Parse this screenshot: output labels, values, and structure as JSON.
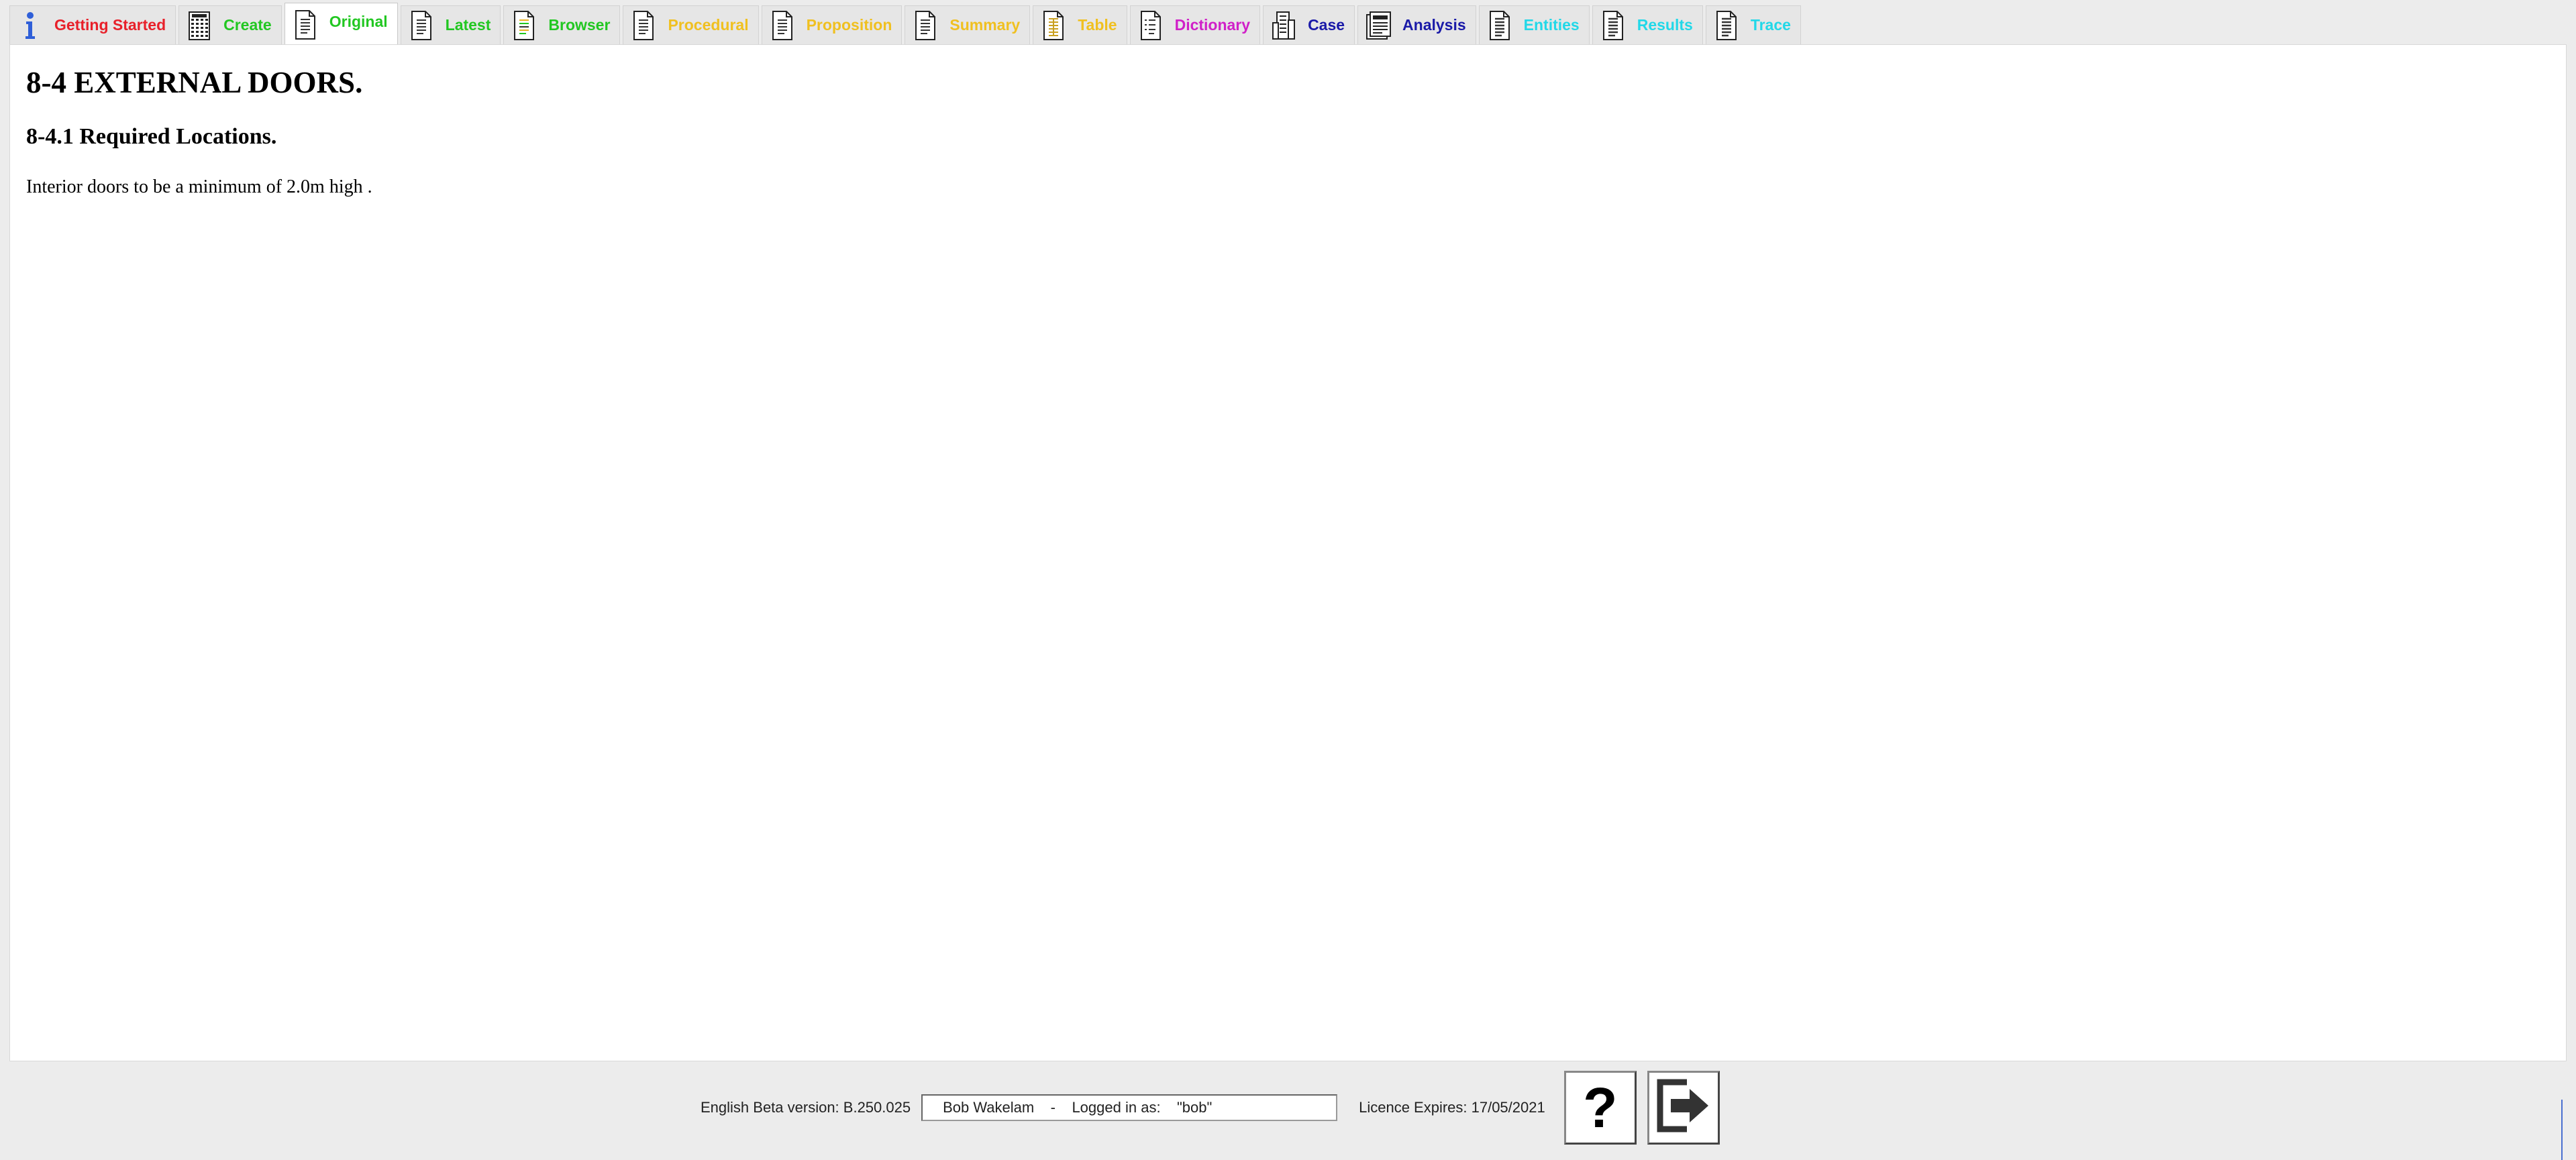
{
  "tabs": [
    {
      "label": "Getting Started",
      "color": "#e8202a",
      "icon": "info-icon",
      "active": false
    },
    {
      "label": "Create",
      "color": "#22c722",
      "icon": "calculator-icon",
      "active": false
    },
    {
      "label": "Original",
      "color": "#22c722",
      "icon": "document-icon",
      "active": true
    },
    {
      "label": "Latest",
      "color": "#22c722",
      "icon": "document-icon",
      "active": false
    },
    {
      "label": "Browser",
      "color": "#22c722",
      "icon": "colored-document-icon",
      "active": false
    },
    {
      "label": "Procedural",
      "color": "#f0c020",
      "icon": "document-icon",
      "active": false
    },
    {
      "label": "Proposition",
      "color": "#f0c020",
      "icon": "document-icon",
      "active": false
    },
    {
      "label": "Summary",
      "color": "#f0c020",
      "icon": "document-icon",
      "active": false
    },
    {
      "label": "Table",
      "color": "#f0c020",
      "icon": "table-document-icon",
      "active": false
    },
    {
      "label": "Dictionary",
      "color": "#d020c8",
      "icon": "dictionary-icon",
      "active": false
    },
    {
      "label": "Case",
      "color": "#1a1aa8",
      "icon": "building-icon",
      "active": false
    },
    {
      "label": "Analysis",
      "color": "#1a1aa8",
      "icon": "analysis-icon",
      "active": false
    },
    {
      "label": "Entities",
      "color": "#22d8e8",
      "icon": "list-document-icon",
      "active": false
    },
    {
      "label": "Results",
      "color": "#22d8e8",
      "icon": "list-document-icon",
      "active": false
    },
    {
      "label": "Trace",
      "color": "#22d8e8",
      "icon": "list-document-icon",
      "active": false
    }
  ],
  "document": {
    "heading": "8-4 EXTERNAL DOORS.",
    "subheading": "8-4.1 Required Locations.",
    "body": "Interior doors to be a minimum of 2.0m high ."
  },
  "status": {
    "version": "English Beta version: B.250.025",
    "user": "Bob Wakelam    -    Logged in as:    \"bob\"",
    "licence": "Licence Expires: 17/05/2021"
  },
  "buttons": {
    "help_icon": "question-mark-icon",
    "help_glyph": "?",
    "exit_icon": "exit-arrow-icon"
  }
}
